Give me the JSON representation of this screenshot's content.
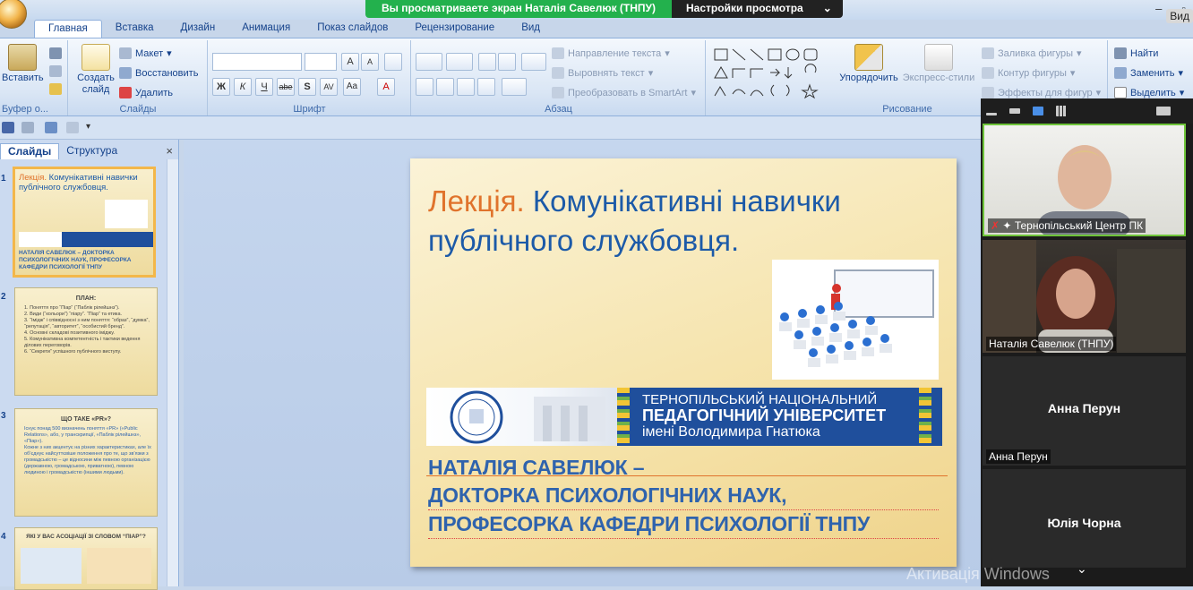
{
  "share": {
    "message": "Вы просматриваете экран Наталія Савелюк (ТНПУ)",
    "settings": "Настройки просмотра",
    "chevron": "⌄"
  },
  "window": {
    "minimize": "–",
    "restore": "▫",
    "partial_label": "Вид"
  },
  "tabs": [
    "Главная",
    "Вставка",
    "Дизайн",
    "Анимация",
    "Показ слайдов",
    "Рецензирование",
    "Вид"
  ],
  "ribbon": {
    "clipboard": {
      "paste": "Вставить",
      "label": "Буфер о..."
    },
    "slides": {
      "create": "Создать",
      "create2": "слайд",
      "layout": "Макет",
      "reset": "Восстановить",
      "delete": "Удалить",
      "label": "Слайды"
    },
    "font": {
      "label": "Шрифт",
      "bold": "Ж",
      "italic": "К",
      "underline": "Ч",
      "strike": "abe",
      "shadow": "S",
      "spacing": "AV",
      "case": "Aa",
      "grow": "A",
      "shrink": "A",
      "color": "A"
    },
    "paragraph": {
      "direction": "Направление текста",
      "align": "Выровнять текст",
      "smartart": "Преобразовать в SmartArt",
      "label": "Абзац"
    },
    "drawing": {
      "arrange": "Упорядочить",
      "styles": "Экспресс-стили",
      "fill": "Заливка фигуры",
      "outline": "Контур фигуры",
      "effects": "Эффекты для фигур",
      "label": "Рисование"
    },
    "editing": {
      "find": "Найти",
      "replace": "Заменить",
      "select": "Выделить"
    }
  },
  "pane": {
    "tab_slides": "Слайды",
    "tab_outline": "Структура",
    "close": "×"
  },
  "thumbnails": [
    {
      "num": "1",
      "title_a": "Лекція.",
      "title_b": " Комунікативні навички публічного службовця.",
      "author": "НАТАЛІЯ САВЕЛЮК – ДОКТОРКА ПСИХОЛОГІЧНИХ НАУК, ПРОФЕСОРКА КАФЕДРИ ПСИХОЛОГІЇ ТНПУ"
    },
    {
      "num": "2",
      "title": "ПЛАН:",
      "lines": [
        "1. Поняття про “Піар” (“Паблік рілейшнз”).",
        "2. Види (“кольори”) “піару”. “Піар” та етика.",
        "3. “Імідж” і співвідносні з ним поняття: “образ”, “думка”, “репутація”, “авторитет”, “особистий бренд”.",
        "4. Основні складові позитивного іміджу.",
        "5. Комунікативна компетентність і тактики ведення ділових переговорів.",
        "6. “Секрети” успішного публічного виступу."
      ]
    },
    {
      "num": "3",
      "title": "ЩО ТАКЕ «PR»?",
      "lines": [
        "Існує понад 500 визначень поняття «PR» («Public Relations», або, у транскрипції, «Паблік рілейшнз», «Піар»).",
        "Кожне з них акцентує на різних характеристиках, але їх об’єднує найсуттєвіше положення про те, що зв’язки з громадськістю – це відносини між певною організацією (державною, громадською, приватною), певною людиною і громадськістю (іншими людьми)."
      ]
    },
    {
      "num": "4",
      "title": "ЯКІ У ВАС АСОЦІАЦІЇ ЗІ СЛОВОМ “ПІАР”?"
    }
  ],
  "slide": {
    "title_a": "Лекція.",
    "title_b": " Комунікативні навички публічного службовця.",
    "uni_1": "ТЕРНОПІЛЬСЬКИЙ НАЦІОНАЛЬНИЙ",
    "uni_2": "ПЕДАГОГІЧНИЙ УНІВЕРСИТЕТ",
    "uni_3": "імені Володимира Гнатюка",
    "author_1": "НАТАЛІЯ САВЕЛЮК –",
    "author_2": "ДОКТОРКА ПСИХОЛОГІЧНИХ НАУК,",
    "author_3": "ПРОФЕСОРКА КАФЕДРИ ПСИХОЛОГІЇ ТНПУ"
  },
  "participants": [
    {
      "name": "Тернопільський Центр ПК",
      "video": true
    },
    {
      "name": "Наталія Савелюк (ТНПУ)",
      "video": true
    },
    {
      "name": "Анна Перун",
      "video": false
    },
    {
      "name": "Юлія Чорна",
      "video": false
    }
  ],
  "watermark": "Активація Windows",
  "colors": {
    "accent_orange": "#e0732c",
    "title_blue": "#1c5aa8",
    "zoom_green": "#23b14d"
  }
}
